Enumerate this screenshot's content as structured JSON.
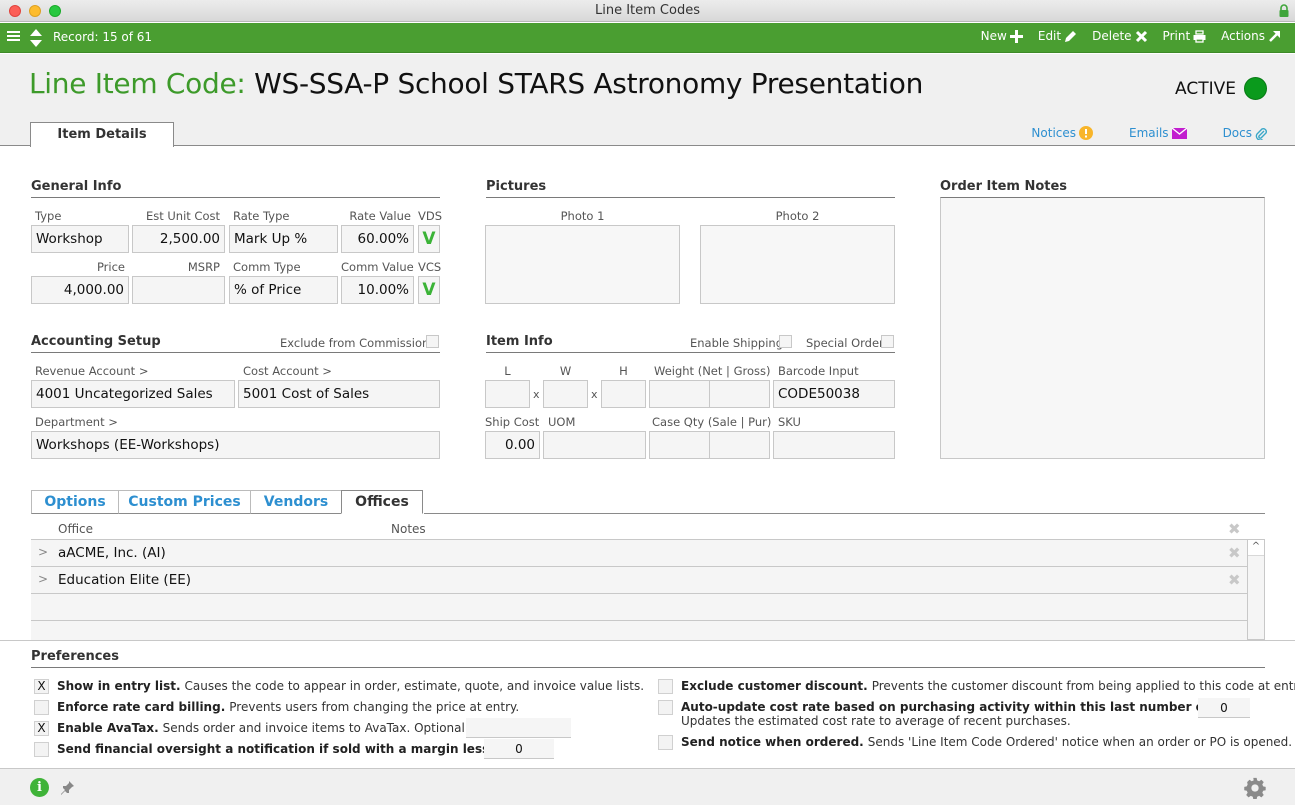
{
  "window": {
    "title": "Line Item Codes"
  },
  "toolbar": {
    "record": "Record: 15 of 61",
    "actions": [
      {
        "label": "New",
        "icon": "plus-icon"
      },
      {
        "label": "Edit",
        "icon": "pencil-icon"
      },
      {
        "label": "Delete",
        "icon": "x-icon"
      },
      {
        "label": "Print",
        "icon": "printer-icon"
      },
      {
        "label": "Actions",
        "icon": "arrow-up-right-icon"
      }
    ]
  },
  "header": {
    "title_prefix": "Line Item Code:",
    "title_name": "WS-SSA-P School STARS Astronomy Presentation",
    "status": "ACTIVE",
    "status_color": "#0a9a1c",
    "tab": "Item Details",
    "links": [
      {
        "label": "Notices",
        "icon": "warning-icon"
      },
      {
        "label": "Emails",
        "icon": "envelope-icon"
      },
      {
        "label": "Docs",
        "icon": "paperclip-icon"
      }
    ]
  },
  "general_info": {
    "title": "General Info",
    "type_label": "Type",
    "type": "Workshop",
    "est_unit_cost_label": "Est Unit Cost",
    "est_unit_cost": "2,500.00",
    "rate_type_label": "Rate Type",
    "rate_type": "Mark Up %",
    "rate_value_label": "Rate Value",
    "rate_value": "60.00%",
    "vds_label": "VDS",
    "vds": "V",
    "price_label": "Price",
    "price": "4,000.00",
    "msrp_label": "MSRP",
    "msrp": "",
    "comm_type_label": "Comm Type",
    "comm_type": "% of Price",
    "comm_value_label": "Comm Value",
    "comm_value": "10.00%",
    "vcs_label": "VCS",
    "vcs": "V"
  },
  "accounting": {
    "title": "Accounting Setup",
    "exclude_commissions_label": "Exclude from Commissions",
    "revenue_label": "Revenue Account >",
    "revenue": "4001 Uncategorized Sales",
    "cost_label": "Cost Account >",
    "cost": "5001 Cost of Sales",
    "department_label": "Department >",
    "department": "Workshops (EE-Workshops)"
  },
  "pictures": {
    "title": "Pictures",
    "photo1": "Photo 1",
    "photo2": "Photo 2"
  },
  "item_info": {
    "title": "Item Info",
    "enable_shipping_label": "Enable Shipping",
    "special_order_label": "Special Order",
    "l_label": "L",
    "w_label": "W",
    "h_label": "H",
    "x": "x",
    "weight_label": "Weight (Net | Gross)",
    "barcode_label": "Barcode Input",
    "barcode": "CODE50038",
    "ship_cost_label": "Ship Cost",
    "ship_cost": "0.00",
    "uom_label": "UOM",
    "case_qty_label": "Case Qty (Sale | Pur)",
    "sku_label": "SKU"
  },
  "notes": {
    "title": "Order Item Notes"
  },
  "lower_tabs": {
    "tabs": [
      "Options",
      "Custom Prices",
      "Vendors",
      "Offices"
    ],
    "active": "Offices",
    "columns": {
      "office": "Office",
      "notes": "Notes"
    },
    "rows": [
      {
        "office": "aACME, Inc.  (AI)",
        "notes": ""
      },
      {
        "office": "Education Elite  (EE)",
        "notes": ""
      }
    ],
    "chevron": ">"
  },
  "preferences": {
    "title": "Preferences",
    "items": [
      {
        "bold": "Show in entry list.",
        "text": "Causes the code to appear in order, estimate, quote, and invoice value lists.",
        "checked": true
      },
      {
        "bold": "Enforce rate card billing.",
        "text": "Prevents users from changing the price at entry.",
        "checked": false
      },
      {
        "bold": "Enable AvaTax.",
        "text": "Sends order and invoice items to AvaTax. Optional code:",
        "checked": true,
        "value": ""
      },
      {
        "bold": "Send financial oversight a notification if sold with a margin less than:",
        "text": "",
        "checked": false,
        "value": "0"
      },
      {
        "bold": "Exclude customer discount.",
        "text": "Prevents the customer discount from being applied to this code at entry.",
        "checked": false
      },
      {
        "bold": "Auto-update cost rate based on purchasing activity within this last number of days:",
        "text": "Updates the estimated cost rate to average of recent purchases.",
        "checked": false,
        "value": "0"
      },
      {
        "bold": "Send notice when ordered.",
        "text": "Sends 'Line Item Code Ordered' notice when an order or PO is opened.",
        "checked": false
      }
    ],
    "check_mark": "X"
  },
  "footer": {
    "info": "i"
  }
}
